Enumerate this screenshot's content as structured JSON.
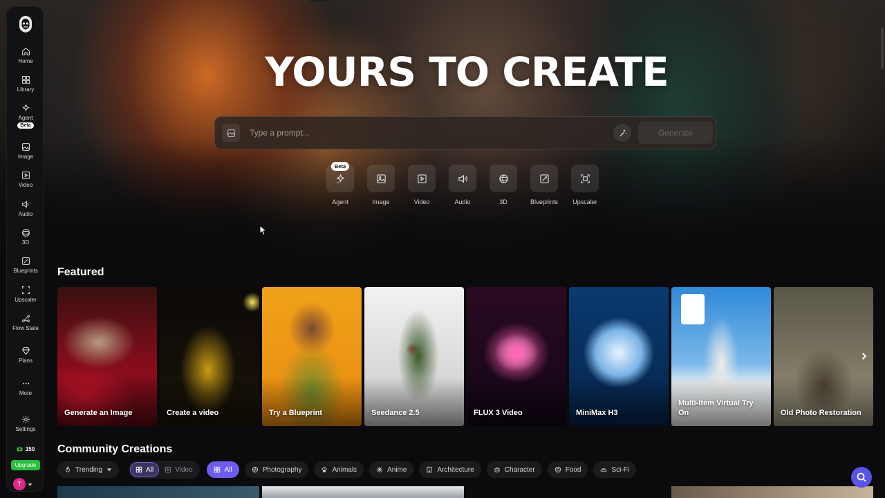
{
  "hero": {
    "title": "YOURS TO CREATE",
    "prompt_placeholder": "Type a prompt...",
    "generate_label": "Generate"
  },
  "tools": [
    {
      "label": "Agent",
      "icon": "agent-icon",
      "badge": "Beta"
    },
    {
      "label": "Image",
      "icon": "image-icon"
    },
    {
      "label": "Video",
      "icon": "video-icon"
    },
    {
      "label": "Audio",
      "icon": "audio-icon"
    },
    {
      "label": "3D",
      "icon": "3d-icon"
    },
    {
      "label": "Blueprints",
      "icon": "blueprints-icon"
    },
    {
      "label": "Upscaler",
      "icon": "upscaler-icon"
    }
  ],
  "sidebar": {
    "items": [
      {
        "label": "Home",
        "icon": "home-icon"
      },
      {
        "label": "Library",
        "icon": "library-icon"
      },
      {
        "label": "Agent",
        "icon": "agent-icon",
        "badge": "Beta"
      },
      {
        "label": "Image",
        "icon": "image-icon"
      },
      {
        "label": "Video",
        "icon": "video-icon"
      },
      {
        "label": "Audio",
        "icon": "audio-icon"
      },
      {
        "label": "3D",
        "icon": "3d-icon"
      },
      {
        "label": "Blueprints",
        "icon": "blueprints-icon"
      },
      {
        "label": "Upscaler",
        "icon": "upscaler-icon"
      },
      {
        "label": "Flow State",
        "icon": "flow-state-icon"
      },
      {
        "label": "Plans",
        "icon": "plans-icon"
      },
      {
        "label": "More",
        "icon": "more-icon"
      },
      {
        "label": "Settings",
        "icon": "settings-icon"
      }
    ],
    "credits": "150",
    "upgrade_label": "Upgrade",
    "avatar_initial": "T"
  },
  "featured": {
    "title": "Featured",
    "cards": [
      {
        "label": "Generate an Image"
      },
      {
        "label": "Create a video"
      },
      {
        "label": "Try a Blueprint"
      },
      {
        "label": "Seedance 2.5"
      },
      {
        "label": "FLUX 3 Video"
      },
      {
        "label": "MiniMax H3"
      },
      {
        "label": "Multi-Item Virtual Try On"
      },
      {
        "label": "Old Photo Restoration"
      }
    ]
  },
  "community": {
    "title": "Community Creations",
    "sort": "Trending",
    "media_filter": [
      "All",
      "Video"
    ],
    "categories": [
      "All",
      "Photography",
      "Animals",
      "Anime",
      "Architecture",
      "Character",
      "Food",
      "Sci-Fi"
    ]
  },
  "colors": {
    "accent": "#6d5cf0",
    "upgrade_green": "#27c13d",
    "avatar_pink": "#e0288a",
    "background": "#0b0b0d"
  }
}
